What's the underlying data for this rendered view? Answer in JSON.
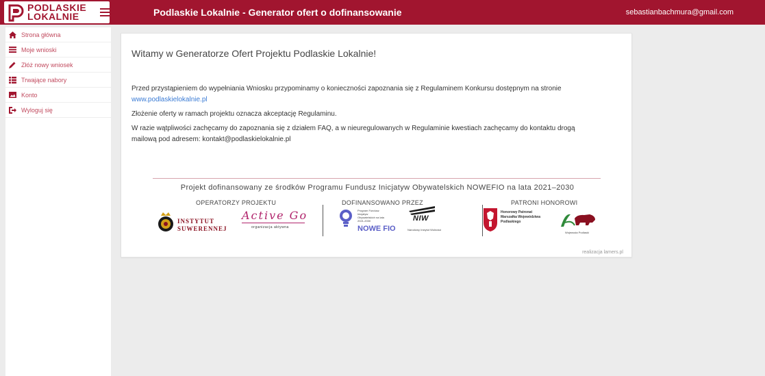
{
  "header": {
    "logo_line1": "PODLASKIE",
    "logo_line2": "LOKALNIE",
    "title": "Podlaskie Lokalnie - Generator ofert o dofinansowanie",
    "user_email": "sebastianbachmura@gmail.com",
    "brand_color": "#a1152f"
  },
  "sidebar": {
    "items": [
      {
        "label": "Strona główna",
        "icon": "home-icon"
      },
      {
        "label": "Moje wnioski",
        "icon": "folder-icon"
      },
      {
        "label": "Złóż nowy wniosek",
        "icon": "pencil-icon"
      },
      {
        "label": "Trwające nabory",
        "icon": "list-icon"
      },
      {
        "label": "Konto",
        "icon": "image-icon"
      },
      {
        "label": "Wyloguj się",
        "icon": "logout-icon"
      }
    ]
  },
  "main": {
    "title": "Witamy w Generatorze Ofert Projektu Podlaskie Lokalnie!",
    "p1": "Przed przystąpieniem do wypełniania Wniosku przypominamy o konieczności zapoznania się z Regulaminem Konkursu dostępnym na stronie",
    "p1_link": "www.podlaskielokalnie.pl",
    "p2": "Złożenie oferty w ramach projektu oznacza akceptację Regulaminu.",
    "p3_line1": "W razie wątpliwości zachęcamy do zapoznania się z działem FAQ, a w nieuregulowanych w Regulaminie kwestiach zachęcamy do kontaktu drogą",
    "p3_line2": "mailową pod adresem: kontakt@podlaskielokalnie.pl",
    "funding_text": "Projekt dofinansowany ze środków Programu Fundusz Inicjatyw Obywatelskich NOWEFIO na lata 2021–2030",
    "operators_label": "OPERATORZY PROJEKTU",
    "funded_by_label": "DOFINANSOWANO PRZEZ",
    "patrons_label": "PATRONI HONOROWI",
    "instytut_line1": "INSTYTUT",
    "instytut_line2": "SUWERENNEJ",
    "activego_name": "Active Go",
    "activego_sub": "organizacja aktywna",
    "nowefio_name": "NOWE FIO",
    "nowefio_small": "Program Fundusz Inicjatyw Obywatelskich na lata 2021-2030",
    "niw_name": "NIW",
    "niw_small": "Narodowy Instytut Wolności",
    "patron_marshal": "Honorowy Patronat Marszałka Województwa Podlaskiego",
    "patron_voivode": "Wojewoda Podlaski",
    "credit": "realizacja lamers.pl"
  }
}
